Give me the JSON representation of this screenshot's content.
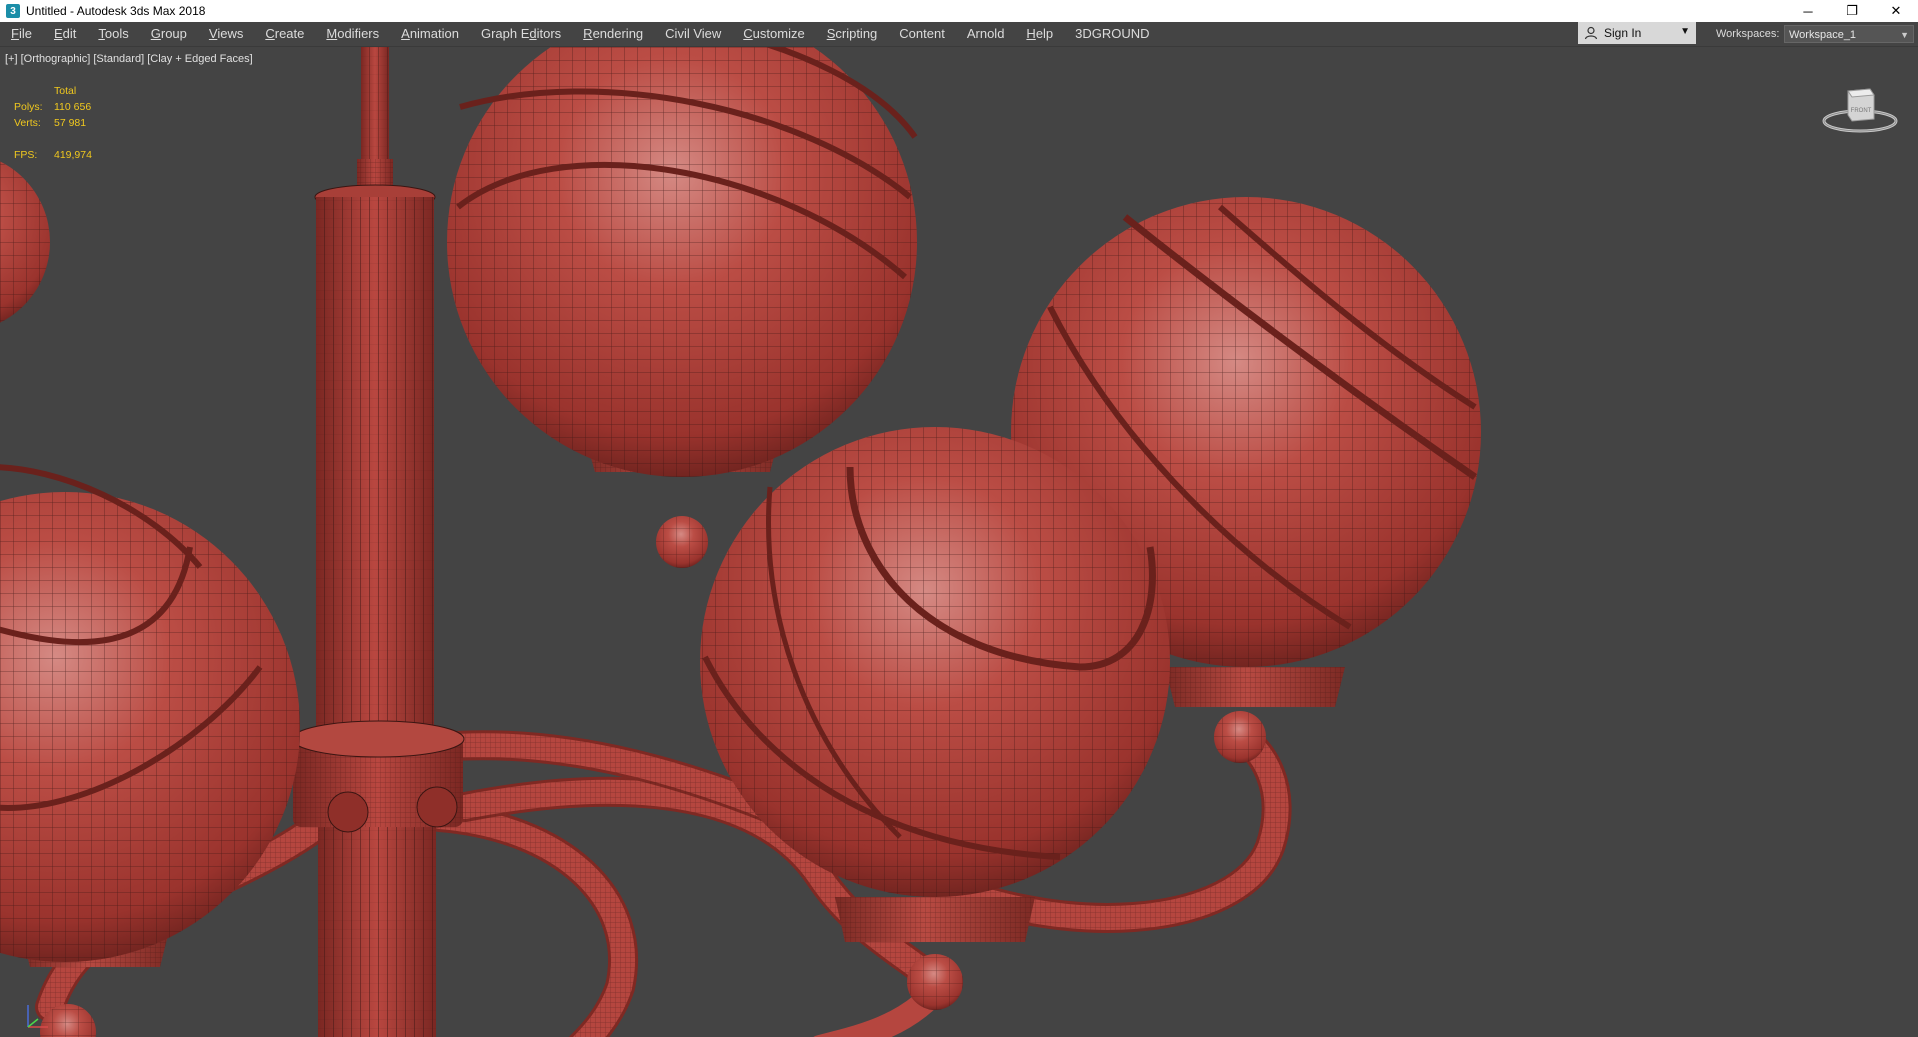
{
  "window": {
    "title": "Untitled - Autodesk 3ds Max 2018",
    "icon": "3ds-max-app-icon",
    "controls": {
      "minimize": "─",
      "restore": "❐",
      "close": "✕"
    }
  },
  "menubar": {
    "items": [
      {
        "pre": "",
        "u": "F",
        "post": "ile"
      },
      {
        "pre": "",
        "u": "E",
        "post": "dit"
      },
      {
        "pre": "",
        "u": "T",
        "post": "ools"
      },
      {
        "pre": "",
        "u": "G",
        "post": "roup"
      },
      {
        "pre": "",
        "u": "V",
        "post": "iews"
      },
      {
        "pre": "",
        "u": "C",
        "post": "reate"
      },
      {
        "pre": "",
        "u": "M",
        "post": "odifiers"
      },
      {
        "pre": "",
        "u": "A",
        "post": "nimation"
      },
      {
        "pre": "Graph E",
        "u": "d",
        "post": "itors"
      },
      {
        "pre": "",
        "u": "R",
        "post": "endering"
      },
      {
        "pre": "Civil View",
        "u": "",
        "post": ""
      },
      {
        "pre": "",
        "u": "C",
        "post": "ustomize"
      },
      {
        "pre": "",
        "u": "S",
        "post": "cripting"
      },
      {
        "pre": "Content",
        "u": "",
        "post": ""
      },
      {
        "pre": "Arnold",
        "u": "",
        "post": ""
      },
      {
        "pre": "",
        "u": "H",
        "post": "elp"
      },
      {
        "pre": "3DGROUND",
        "u": "",
        "post": ""
      }
    ],
    "sign_in": "Sign In",
    "workspaces_label": "Workspaces:",
    "workspace_value": "Workspace_1"
  },
  "viewport": {
    "labels": [
      "[+]",
      "[Orthographic]",
      "[Standard]",
      "[Clay + Edged Faces]"
    ],
    "stats": {
      "header": "Total",
      "polys_label": "Polys:",
      "polys_value": "110 656",
      "verts_label": "Verts:",
      "verts_value": "57 981",
      "fps_label": "FPS:",
      "fps_value": "419,974"
    },
    "viewcube_face": "FRONT",
    "model_color": "#b8453e",
    "background_color": "#444444",
    "stat_color": "#f0c81e"
  }
}
